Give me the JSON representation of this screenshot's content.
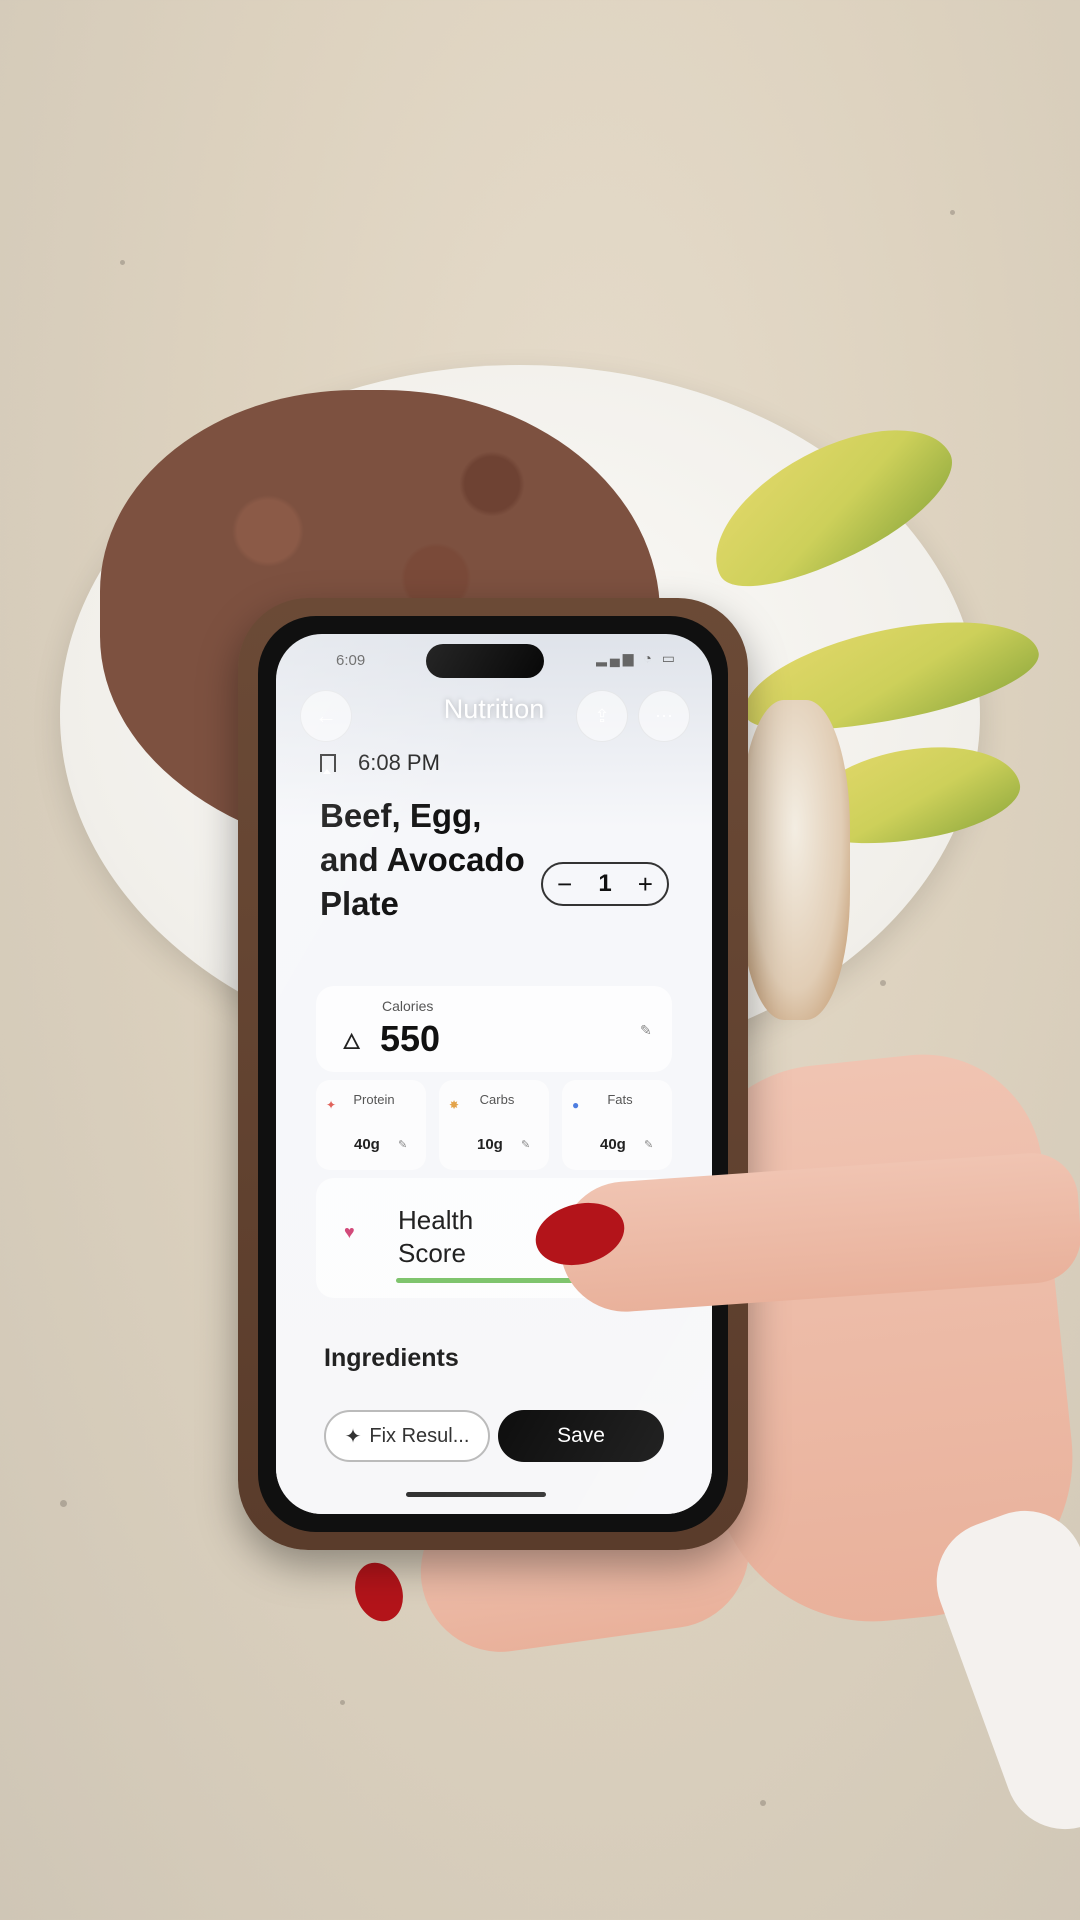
{
  "status_bar": {
    "time": "6:09"
  },
  "nav": {
    "title": "Nutrition",
    "back_icon": "arrow-left-icon",
    "share_icon": "share-icon",
    "more_icon": "more-icon"
  },
  "meal": {
    "time": "6:08 PM",
    "title": "Beef, Egg, and Avocado Plate",
    "quantity": "1",
    "minus": "−",
    "plus": "+"
  },
  "calories": {
    "label": "Calories",
    "value": "550"
  },
  "macros": [
    {
      "label": "Protein",
      "value": "40g",
      "color": "#e0625a"
    },
    {
      "label": "Carbs",
      "value": "10g",
      "color": "#e3a34a"
    },
    {
      "label": "Fats",
      "value": "40g",
      "color": "#4e7de0"
    }
  ],
  "health_score": {
    "label": "Health Score",
    "fill_fraction": 0.8,
    "bar_color": "#7fc46d"
  },
  "ingredients_heading": "Ingredients",
  "actions": {
    "fix_label": "Fix Resul...",
    "save_label": "Save"
  }
}
